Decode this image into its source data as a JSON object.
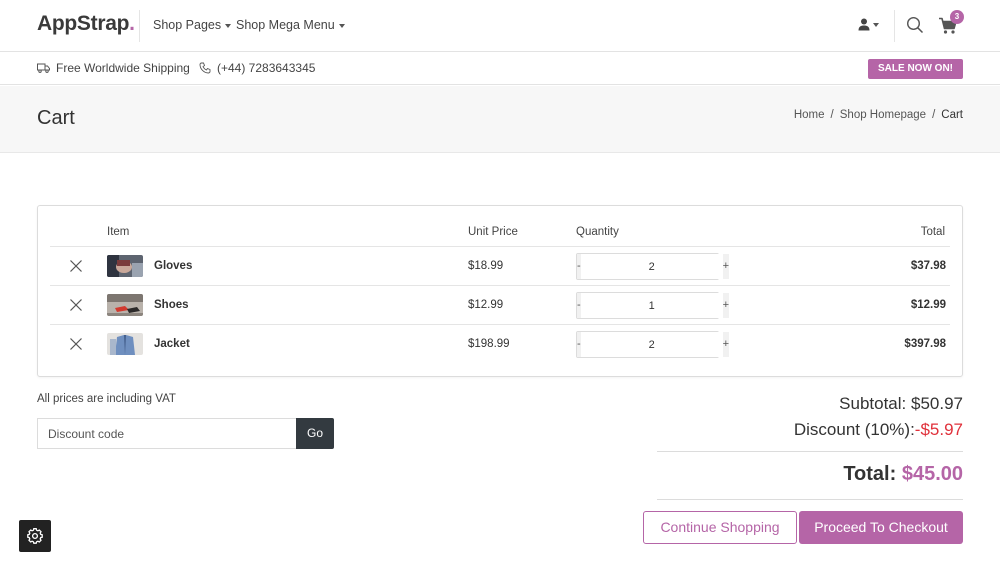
{
  "brand": {
    "name_main": "AppStrap",
    "name_accent": "."
  },
  "nav": {
    "items": [
      {
        "label": "Shop Pages"
      },
      {
        "label": "Shop Mega Menu"
      }
    ],
    "cart_count": "3",
    "icons": [
      "user-icon",
      "search-icon",
      "cart-icon"
    ]
  },
  "infobar": {
    "shipping": "Free Worldwide Shipping",
    "phone": "(+44) 7283643345",
    "sale": "SALE NOW ON!"
  },
  "page": {
    "title": "Cart",
    "breadcrumb": [
      {
        "label": "Home"
      },
      {
        "label": "Shop Homepage"
      },
      {
        "label": "Cart"
      }
    ],
    "breadcrumb_sep": "/"
  },
  "cart": {
    "headers": {
      "item": "Item",
      "unit_price": "Unit Price",
      "quantity": "Quantity",
      "total": "Total"
    },
    "rows": [
      {
        "name": "Gloves",
        "unit_price": "$18.99",
        "qty": "2",
        "total": "$37.98"
      },
      {
        "name": "Shoes",
        "unit_price": "$12.99",
        "qty": "1",
        "total": "$12.99"
      },
      {
        "name": "Jacket",
        "unit_price": "$198.99",
        "qty": "2",
        "total": "$397.98"
      }
    ],
    "minus": "-",
    "plus": "+"
  },
  "checkout": {
    "vat_note": "All prices are including VAT",
    "discount_placeholder": "Discount code",
    "go_label": "Go",
    "subtotal_label": "Subtotal:",
    "subtotal_value": "$50.97",
    "discount_label": "Discount (10%):",
    "discount_value": "-$5.97",
    "total_label": "Total:",
    "total_value": "$45.00",
    "continue_label": "Continue Shopping",
    "checkout_label": "Proceed To Checkout"
  },
  "colors": {
    "accent": "#b565a7",
    "negative": "#e0303a",
    "dark_button": "#333a40"
  }
}
